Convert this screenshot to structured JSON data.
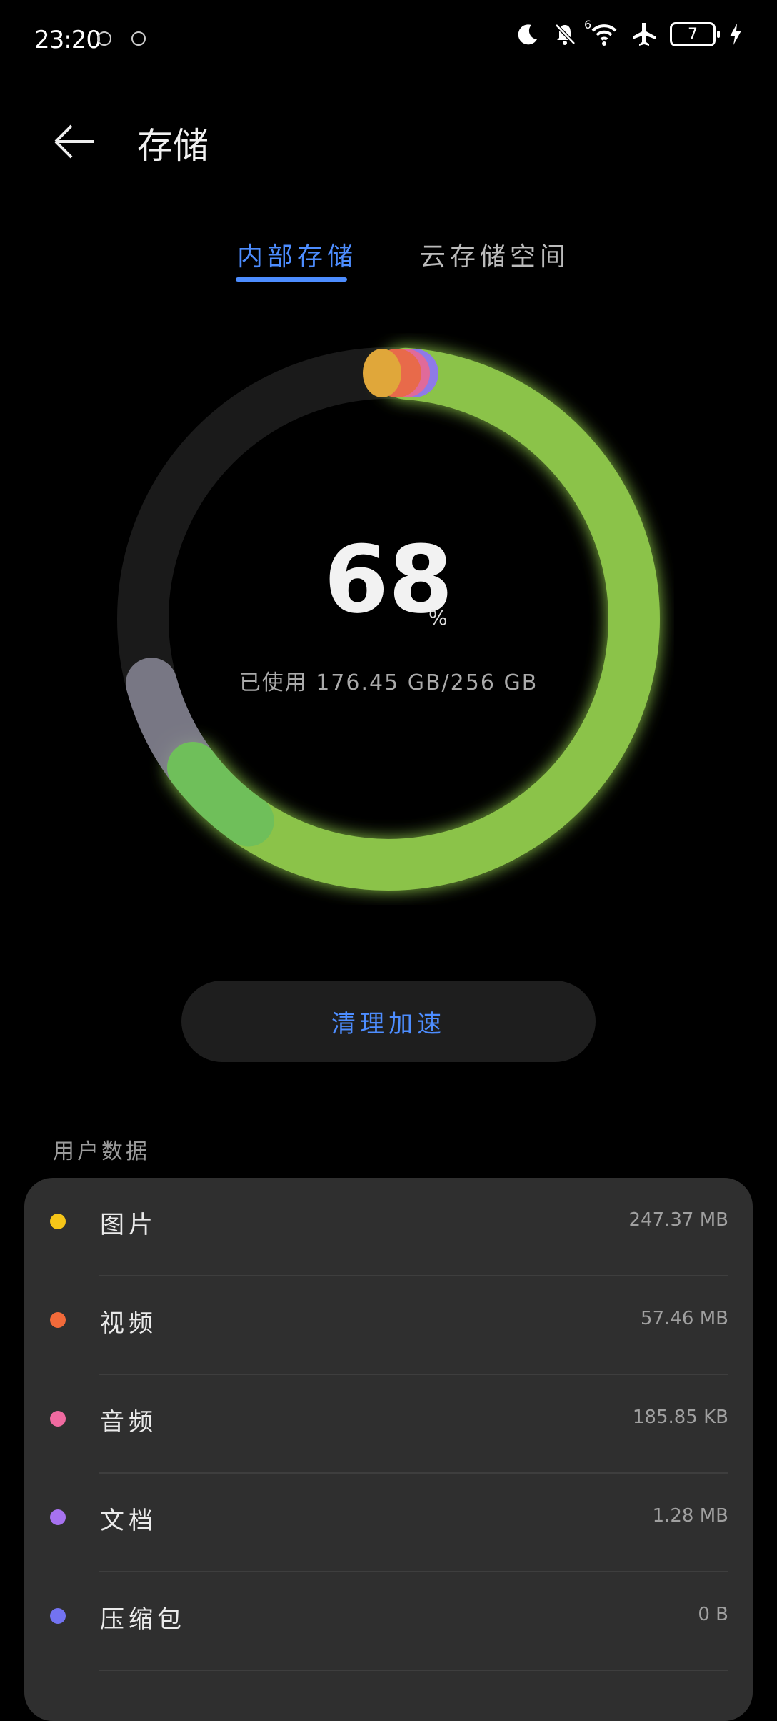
{
  "status_bar": {
    "time": "23:20",
    "signal_label": "6",
    "battery": "7",
    "icons": [
      "moon-icon",
      "bell-off-icon",
      "wifi-icon",
      "airplane-icon",
      "battery-icon",
      "charging-icon"
    ]
  },
  "header": {
    "title": "存储",
    "back_icon": "arrow-left-icon"
  },
  "tabs": [
    {
      "label": "内部存储",
      "active": true
    },
    {
      "label": "云存储空间",
      "active": false
    }
  ],
  "storage": {
    "percent": "68",
    "percent_symbol": "%",
    "used_text": "已使用 176.45 GB/256 GB",
    "used_fraction": 0.68
  },
  "clean_button": {
    "label": "清理加速"
  },
  "user_data": {
    "section_title": "用户数据",
    "items": [
      {
        "label": "图片",
        "value": "247.37 MB",
        "color": "#f5c518"
      },
      {
        "label": "视频",
        "value": "57.46 MB",
        "color": "#f26a3a"
      },
      {
        "label": "音频",
        "value": "185.85 KB",
        "color": "#f06aa0"
      },
      {
        "label": "文档",
        "value": "1.28 MB",
        "color": "#a772f0"
      },
      {
        "label": "压缩包",
        "value": "0 B",
        "color": "#7373f2"
      }
    ]
  },
  "colors": {
    "accent": "#4d8dff",
    "ring_green": "#8bc34a",
    "ring_bg": "#1a1a1a",
    "ring_gray": "#8a8898"
  }
}
